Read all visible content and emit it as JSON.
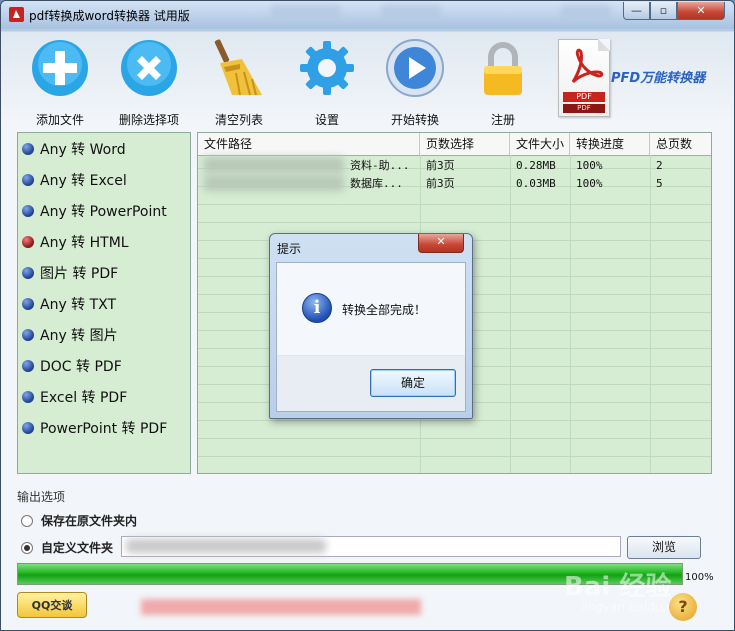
{
  "window": {
    "title": "pdf转换成word转换器 试用版",
    "controls": {
      "minimize": "—",
      "maximize": "▫",
      "close": "✕"
    }
  },
  "toolbar": {
    "add_file": "添加文件",
    "delete_selected": "删除选择项",
    "clear_list": "清空列表",
    "settings": "设置",
    "start_convert": "开始转换",
    "register": "注册"
  },
  "brand": {
    "text": "PFD万能转换器",
    "doc_tag": "PDF",
    "doc_tag2": "PDF"
  },
  "sidebar": {
    "items": [
      {
        "label": "Any 转 Word",
        "dot": "blue"
      },
      {
        "label": "Any 转 Excel",
        "dot": "blue"
      },
      {
        "label": "Any 转 PowerPoint",
        "dot": "blue"
      },
      {
        "label": "Any 转 HTML",
        "dot": "red"
      },
      {
        "label": "图片 转 PDF",
        "dot": "blue"
      },
      {
        "label": "Any 转 TXT",
        "dot": "blue"
      },
      {
        "label": "Any 转 图片",
        "dot": "blue"
      },
      {
        "label": "DOC 转 PDF",
        "dot": "blue"
      },
      {
        "label": "Excel 转 PDF",
        "dot": "blue"
      },
      {
        "label": "PowerPoint 转 PDF",
        "dot": "blue"
      }
    ]
  },
  "table": {
    "headers": [
      "文件路径",
      "页数选择",
      "文件大小",
      "转换进度",
      "总页数"
    ],
    "rows": [
      {
        "path": "资料-助...",
        "pages": "前3页",
        "size": "0.28MB",
        "progress": "100%",
        "total": "2"
      },
      {
        "path": "数据库...",
        "pages": "前3页",
        "size": "0.03MB",
        "progress": "100%",
        "total": "5"
      }
    ]
  },
  "output": {
    "title": "输出选项",
    "option_original": "保存在原文件夹内",
    "option_custom": "自定义文件夹",
    "selected": "custom",
    "browse": "浏览"
  },
  "progress": {
    "value": 1.0,
    "label": "100%"
  },
  "qq_button": "QQ交谈",
  "help": "?",
  "watermark": {
    "text": "Bai 经验",
    "sub": "jingyan.baidu.com"
  },
  "dialog": {
    "title": "提示",
    "close": "✕",
    "icon": "info-icon",
    "message": "转换全部完成！",
    "ok": "确定"
  },
  "colors": {
    "accent": "#2a62c4",
    "list_bg": "#d6ecd3",
    "progress_green": "#1fb71f",
    "close_red": "#c74634"
  }
}
